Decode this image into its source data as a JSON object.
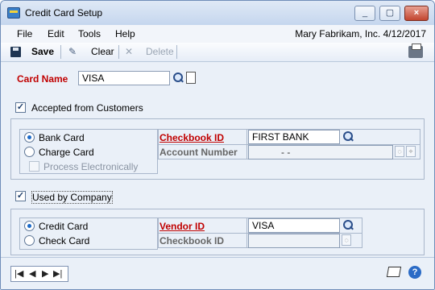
{
  "window": {
    "title": "Credit Card Setup"
  },
  "menu": {
    "file": "File",
    "edit": "Edit",
    "tools": "Tools",
    "help": "Help",
    "company_info": "Mary  Fabrikam, Inc.  4/12/2017"
  },
  "toolbar": {
    "save": "Save",
    "clear": "Clear",
    "delete": "Delete"
  },
  "card_name": {
    "label": "Card Name",
    "value": "VISA"
  },
  "accepted": {
    "label": "Accepted from Customers",
    "checked": true
  },
  "customer_types": {
    "bank_card": "Bank Card",
    "charge_card": "Charge Card",
    "process_electronically": "Process Electronically",
    "selected": "Bank Card"
  },
  "checkbook": {
    "label": "Checkbook ID",
    "value": "FIRST BANK"
  },
  "account_number": {
    "label": "Account Number",
    "value": "-         -"
  },
  "used_by_company": {
    "label": "Used by Company",
    "checked": true
  },
  "company_types": {
    "credit_card": "Credit Card",
    "check_card": "Check Card",
    "selected": "Credit Card"
  },
  "vendor": {
    "label": "Vendor ID",
    "value": "VISA"
  },
  "company_checkbook": {
    "label": "Checkbook ID",
    "value": ""
  },
  "status": {
    "nav_first": "|◀",
    "nav_prev": "◀",
    "nav_next": "▶",
    "nav_last": "▶|",
    "help": "?"
  },
  "icons": {
    "app": "credit-card-setup-icon",
    "lookup": "magnifier-icon",
    "new": "new-document-icon",
    "note": "note-icon",
    "help": "help-icon",
    "print": "printer-icon"
  },
  "colors": {
    "required": "#c00000",
    "window_bg": "#eaf0f8",
    "accent": "#1b6ac9"
  }
}
